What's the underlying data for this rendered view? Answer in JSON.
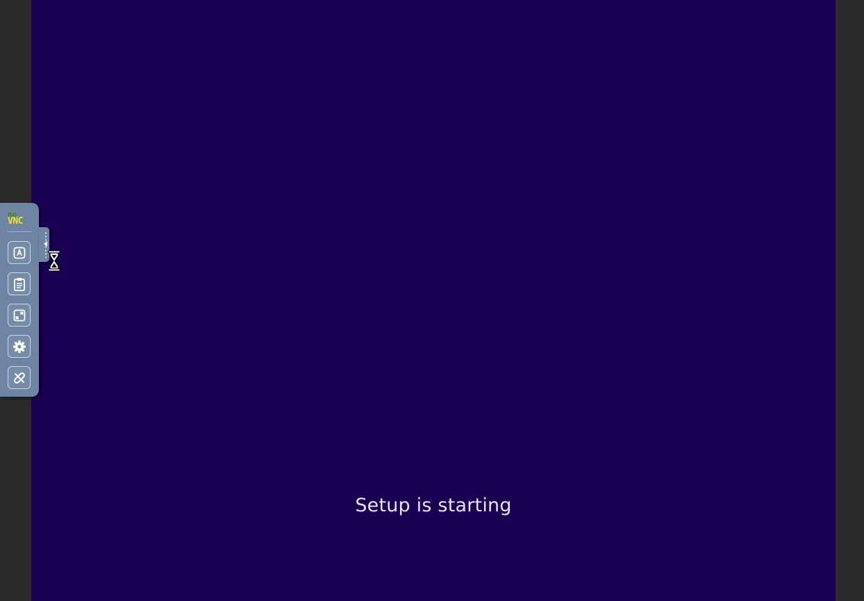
{
  "screen": {
    "status_text": "Setup is starting",
    "background_color": "#1a0052"
  },
  "control_bar": {
    "logo": {
      "line1": "no",
      "line2": "VNC"
    },
    "buttons": [
      {
        "icon": "keyboard-icon",
        "tooltip": ""
      },
      {
        "icon": "clipboard-icon",
        "tooltip": ""
      },
      {
        "icon": "fullscreen-icon",
        "tooltip": ""
      },
      {
        "icon": "gear-icon",
        "tooltip": ""
      },
      {
        "icon": "disconnect-icon",
        "tooltip": ""
      }
    ],
    "accent_color": "#6e84a3"
  },
  "cursor": {
    "type": "hourglass-icon"
  }
}
